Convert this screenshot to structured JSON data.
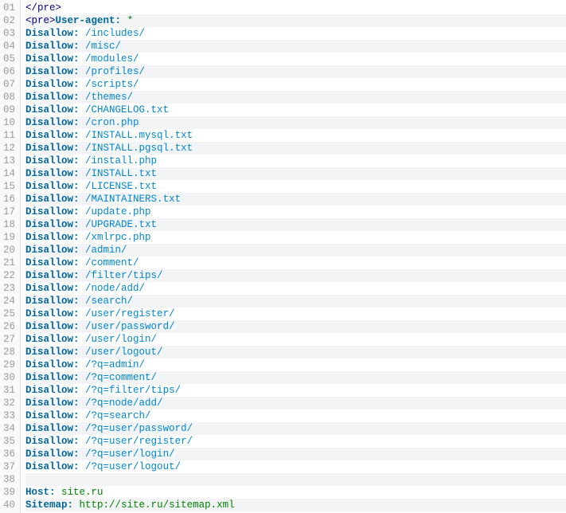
{
  "lines": [
    [
      {
        "t": "tag",
        "v": "</pre>"
      }
    ],
    [
      {
        "t": "tag",
        "v": "<pre>"
      },
      {
        "t": "key",
        "v": "User-agent:"
      },
      {
        "t": "txt",
        "v": " "
      },
      {
        "t": "val",
        "v": "*"
      }
    ],
    [
      {
        "t": "key",
        "v": "Disallow:"
      },
      {
        "t": "txt",
        "v": " "
      },
      {
        "t": "dir",
        "v": "/includes/"
      }
    ],
    [
      {
        "t": "key",
        "v": "Disallow:"
      },
      {
        "t": "txt",
        "v": " "
      },
      {
        "t": "dir",
        "v": "/misc/"
      }
    ],
    [
      {
        "t": "key",
        "v": "Disallow:"
      },
      {
        "t": "txt",
        "v": " "
      },
      {
        "t": "dir",
        "v": "/modules/"
      }
    ],
    [
      {
        "t": "key",
        "v": "Disallow:"
      },
      {
        "t": "txt",
        "v": " "
      },
      {
        "t": "dir",
        "v": "/profiles/"
      }
    ],
    [
      {
        "t": "key",
        "v": "Disallow:"
      },
      {
        "t": "txt",
        "v": " "
      },
      {
        "t": "dir",
        "v": "/scripts/"
      }
    ],
    [
      {
        "t": "key",
        "v": "Disallow:"
      },
      {
        "t": "txt",
        "v": " "
      },
      {
        "t": "dir",
        "v": "/themes/"
      }
    ],
    [
      {
        "t": "key",
        "v": "Disallow:"
      },
      {
        "t": "txt",
        "v": " "
      },
      {
        "t": "dir",
        "v": "/CHANGELOG.txt"
      }
    ],
    [
      {
        "t": "key",
        "v": "Disallow:"
      },
      {
        "t": "txt",
        "v": " "
      },
      {
        "t": "dir",
        "v": "/cron.php"
      }
    ],
    [
      {
        "t": "key",
        "v": "Disallow:"
      },
      {
        "t": "txt",
        "v": " "
      },
      {
        "t": "dir",
        "v": "/INSTALL.mysql.txt"
      }
    ],
    [
      {
        "t": "key",
        "v": "Disallow:"
      },
      {
        "t": "txt",
        "v": " "
      },
      {
        "t": "dir",
        "v": "/INSTALL.pgsql.txt"
      }
    ],
    [
      {
        "t": "key",
        "v": "Disallow:"
      },
      {
        "t": "txt",
        "v": " "
      },
      {
        "t": "dir",
        "v": "/install.php"
      }
    ],
    [
      {
        "t": "key",
        "v": "Disallow:"
      },
      {
        "t": "txt",
        "v": " "
      },
      {
        "t": "dir",
        "v": "/INSTALL.txt"
      }
    ],
    [
      {
        "t": "key",
        "v": "Disallow:"
      },
      {
        "t": "txt",
        "v": " "
      },
      {
        "t": "dir",
        "v": "/LICENSE.txt"
      }
    ],
    [
      {
        "t": "key",
        "v": "Disallow:"
      },
      {
        "t": "txt",
        "v": " "
      },
      {
        "t": "dir",
        "v": "/MAINTAINERS.txt"
      }
    ],
    [
      {
        "t": "key",
        "v": "Disallow:"
      },
      {
        "t": "txt",
        "v": " "
      },
      {
        "t": "dir",
        "v": "/update.php"
      }
    ],
    [
      {
        "t": "key",
        "v": "Disallow:"
      },
      {
        "t": "txt",
        "v": " "
      },
      {
        "t": "dir",
        "v": "/UPGRADE.txt"
      }
    ],
    [
      {
        "t": "key",
        "v": "Disallow:"
      },
      {
        "t": "txt",
        "v": " "
      },
      {
        "t": "dir",
        "v": "/xmlrpc.php"
      }
    ],
    [
      {
        "t": "key",
        "v": "Disallow:"
      },
      {
        "t": "txt",
        "v": " "
      },
      {
        "t": "dir",
        "v": "/admin/"
      }
    ],
    [
      {
        "t": "key",
        "v": "Disallow:"
      },
      {
        "t": "txt",
        "v": " "
      },
      {
        "t": "dir",
        "v": "/comment/"
      }
    ],
    [
      {
        "t": "key",
        "v": "Disallow:"
      },
      {
        "t": "txt",
        "v": " "
      },
      {
        "t": "dir",
        "v": "/filter/tips/"
      }
    ],
    [
      {
        "t": "key",
        "v": "Disallow:"
      },
      {
        "t": "txt",
        "v": " "
      },
      {
        "t": "dir",
        "v": "/node/add/"
      }
    ],
    [
      {
        "t": "key",
        "v": "Disallow:"
      },
      {
        "t": "txt",
        "v": " "
      },
      {
        "t": "dir",
        "v": "/search/"
      }
    ],
    [
      {
        "t": "key",
        "v": "Disallow:"
      },
      {
        "t": "txt",
        "v": " "
      },
      {
        "t": "dir",
        "v": "/user/register/"
      }
    ],
    [
      {
        "t": "key",
        "v": "Disallow:"
      },
      {
        "t": "txt",
        "v": " "
      },
      {
        "t": "dir",
        "v": "/user/password/"
      }
    ],
    [
      {
        "t": "key",
        "v": "Disallow:"
      },
      {
        "t": "txt",
        "v": " "
      },
      {
        "t": "dir",
        "v": "/user/login/"
      }
    ],
    [
      {
        "t": "key",
        "v": "Disallow:"
      },
      {
        "t": "txt",
        "v": " "
      },
      {
        "t": "dir",
        "v": "/user/logout/"
      }
    ],
    [
      {
        "t": "key",
        "v": "Disallow:"
      },
      {
        "t": "txt",
        "v": " "
      },
      {
        "t": "dir",
        "v": "/?q=admin/"
      }
    ],
    [
      {
        "t": "key",
        "v": "Disallow:"
      },
      {
        "t": "txt",
        "v": " "
      },
      {
        "t": "dir",
        "v": "/?q=comment/"
      }
    ],
    [
      {
        "t": "key",
        "v": "Disallow:"
      },
      {
        "t": "txt",
        "v": " "
      },
      {
        "t": "dir",
        "v": "/?q=filter/tips/"
      }
    ],
    [
      {
        "t": "key",
        "v": "Disallow:"
      },
      {
        "t": "txt",
        "v": " "
      },
      {
        "t": "dir",
        "v": "/?q=node/add/"
      }
    ],
    [
      {
        "t": "key",
        "v": "Disallow:"
      },
      {
        "t": "txt",
        "v": " "
      },
      {
        "t": "dir",
        "v": "/?q=search/"
      }
    ],
    [
      {
        "t": "key",
        "v": "Disallow:"
      },
      {
        "t": "txt",
        "v": " "
      },
      {
        "t": "dir",
        "v": "/?q=user/password/"
      }
    ],
    [
      {
        "t": "key",
        "v": "Disallow:"
      },
      {
        "t": "txt",
        "v": " "
      },
      {
        "t": "dir",
        "v": "/?q=user/register/"
      }
    ],
    [
      {
        "t": "key",
        "v": "Disallow:"
      },
      {
        "t": "txt",
        "v": " "
      },
      {
        "t": "dir",
        "v": "/?q=user/login/"
      }
    ],
    [
      {
        "t": "key",
        "v": "Disallow:"
      },
      {
        "t": "txt",
        "v": " "
      },
      {
        "t": "dir",
        "v": "/?q=user/logout/"
      }
    ],
    [],
    [
      {
        "t": "key",
        "v": "Host:"
      },
      {
        "t": "txt",
        "v": " "
      },
      {
        "t": "val",
        "v": "site.ru"
      }
    ],
    [
      {
        "t": "key",
        "v": "Sitemap:"
      },
      {
        "t": "txt",
        "v": " "
      },
      {
        "t": "val",
        "v": "http://site.ru/sitemap.xml"
      }
    ]
  ]
}
